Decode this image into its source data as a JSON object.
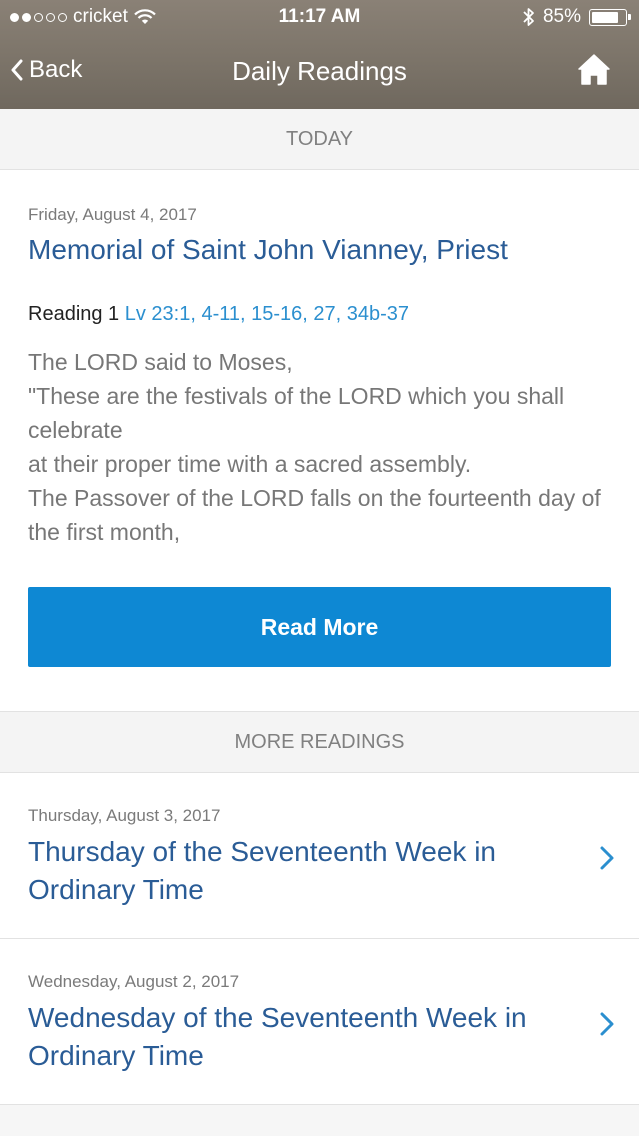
{
  "status_bar": {
    "carrier": "cricket",
    "signal_bars_filled": 2,
    "signal_bars_total": 5,
    "time": "11:17 AM",
    "battery_percent": "85%",
    "battery_level": 0.85
  },
  "nav": {
    "back_label": "Back",
    "title": "Daily Readings",
    "home_icon": "home-icon"
  },
  "today": {
    "section_label": "TODAY",
    "date": "Friday, August 4, 2017",
    "feast": "Memorial of Saint John Vianney, Priest",
    "reading_label": "Reading 1",
    "reading_ref": "Lv 23:1, 4-11, 15-16, 27, 34b-37",
    "excerpt_lines": [
      "The LORD said to Moses,",
      "\"These are the festivals of the LORD which you shall celebrate",
      "at their proper time with a sacred assembly.",
      "The Passover of the LORD falls on the fourteenth day of the first month,"
    ],
    "read_more_label": "Read More"
  },
  "more": {
    "section_label": "MORE READINGS",
    "items": [
      {
        "date": "Thursday, August 3, 2017",
        "title": "Thursday of the Seventeenth Week in Ordinary Time"
      },
      {
        "date": "Wednesday, August 2, 2017",
        "title": "Wednesday of the Seventeenth Week in Ordinary Time"
      }
    ]
  },
  "colors": {
    "accent_blue": "#0e88d3",
    "title_blue": "#2a5c96",
    "link_blue": "#2b8fcf",
    "header_bg": "#7c7469"
  }
}
